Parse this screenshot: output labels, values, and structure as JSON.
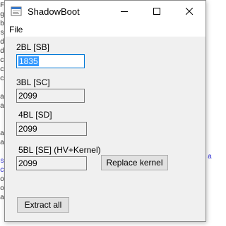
{
  "window": {
    "title": "ShadowBoot",
    "app_icon": "app-icon",
    "controls": {
      "minimize_icon": "minimize-icon",
      "maximize_icon": "maximize-icon",
      "close_icon": "close-icon"
    }
  },
  "menu": {
    "file_label": "File"
  },
  "fields": [
    {
      "label": "2BL [SB]",
      "value": "1835"
    },
    {
      "label": "3BL [SC]",
      "value": "2099"
    },
    {
      "label": "4BL [SD]",
      "value": "2099"
    },
    {
      "label": "5BL [SE] (HV+Kernel)",
      "value": "2099"
    }
  ],
  "buttons": {
    "replace_kernel": "Replace kernel",
    "extract_all": "Extract all"
  },
  "colors": {
    "window_bg": "#f0f0f0",
    "titlebar_bg": "#ffffff",
    "focus_border": "#0078d7",
    "selection": "#3399ff",
    "button_bg": "#e1e1e1"
  }
}
